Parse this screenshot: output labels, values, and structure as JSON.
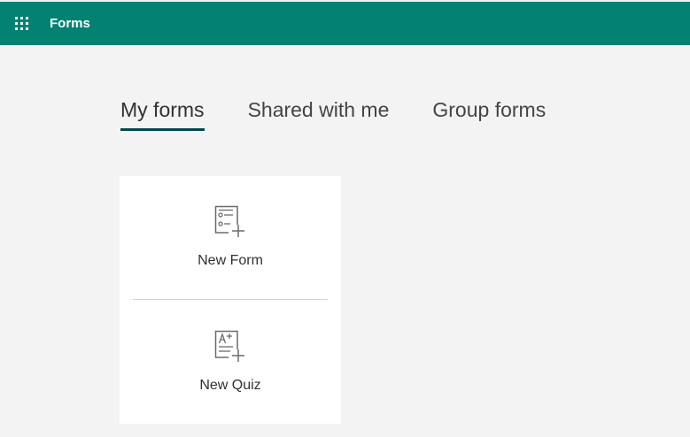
{
  "suite_bar": {
    "app_title": "Forms",
    "background_color": "#038272",
    "launcher_icon": "app-launcher-waffle-icon"
  },
  "tabs": [
    {
      "label": "My forms",
      "selected": true
    },
    {
      "label": "Shared with me",
      "selected": false
    },
    {
      "label": "Group forms",
      "selected": false
    }
  ],
  "new_card": {
    "new_form": {
      "label": "New Form",
      "icon": "new-form-icon"
    },
    "new_quiz": {
      "label": "New Quiz",
      "icon": "new-quiz-icon"
    }
  }
}
